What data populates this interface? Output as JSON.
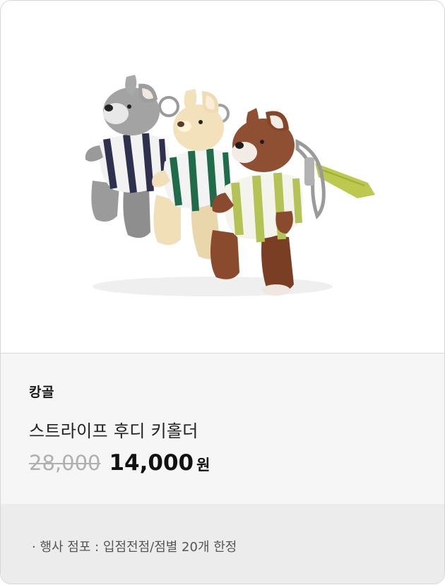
{
  "product": {
    "image_alt": "스트라이프 후디 키홀더 상품 이미지",
    "brand": "캉골",
    "name": "스트라이프 후디 키홀더",
    "original_price": "28,000",
    "sale_price": "14,000",
    "currency": "원"
  },
  "notice": {
    "text": "· 행사 점포 : 입점전점/점별 20개 한정"
  },
  "colors": {
    "sale_price": "#111111",
    "original_price": "#b0b0b0",
    "info_background": "#f6f6f6",
    "notice_background": "#ececec"
  }
}
